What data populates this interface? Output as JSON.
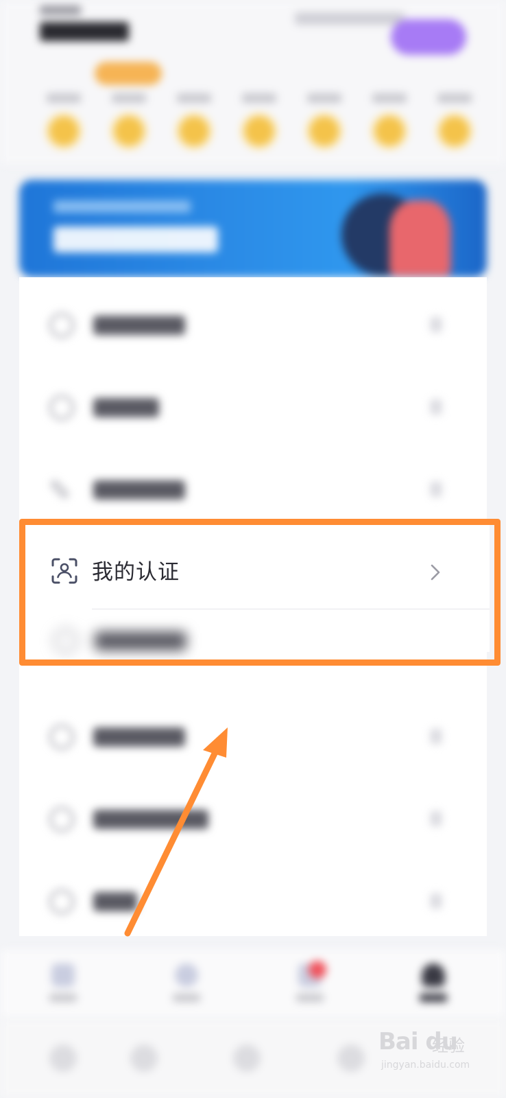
{
  "certification": {
    "label": "我的认证",
    "icon": "face-id-scan-icon",
    "chevron_icon": "chevron-right-icon"
  },
  "annotation": {
    "highlight_color": "#ff8c33",
    "arrow_color": "#ff8c33"
  },
  "watermark": {
    "brand": "Bai du",
    "text": "经验",
    "url": "jingyan.baidu.com"
  },
  "colors": {
    "banner": "#2b8be6",
    "header_button": "#a77bf5",
    "coin": "#f4c34a",
    "badge": "#f6b455",
    "notification_dot": "#f0525c"
  }
}
